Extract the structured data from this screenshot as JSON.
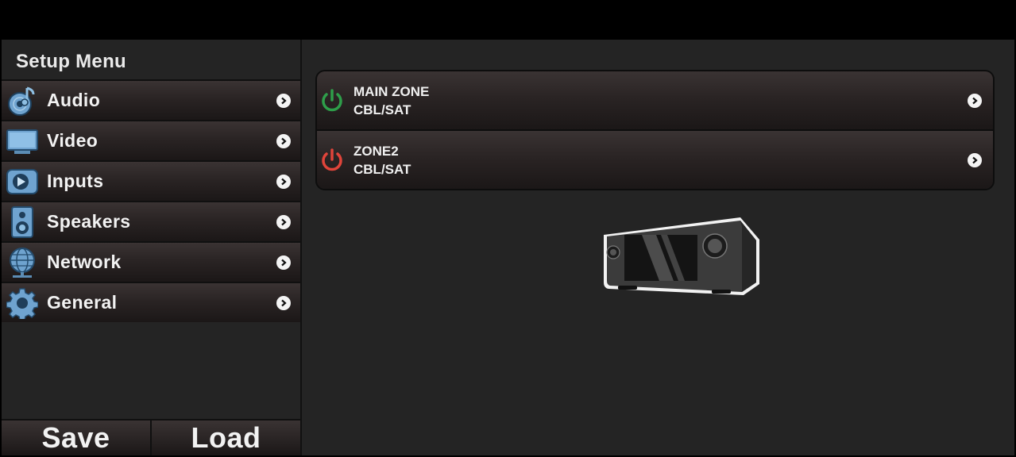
{
  "sidebar": {
    "title": "Setup Menu",
    "items": [
      {
        "label": "Audio",
        "icon": "audio-disc-icon"
      },
      {
        "label": "Video",
        "icon": "monitor-icon"
      },
      {
        "label": "Inputs",
        "icon": "input-arrow-icon"
      },
      {
        "label": "Speakers",
        "icon": "speaker-icon"
      },
      {
        "label": "Network",
        "icon": "globe-icon"
      },
      {
        "label": "General",
        "icon": "gear-icon"
      }
    ]
  },
  "footer": {
    "save_label": "Save",
    "load_label": "Load"
  },
  "zones": [
    {
      "name": "MAIN ZONE",
      "source": "CBL/SAT",
      "power_color": "#2e9e4a"
    },
    {
      "name": "ZONE2",
      "source": "CBL/SAT",
      "power_color": "#e0443a"
    }
  ],
  "colors": {
    "panel": "#242424",
    "accent_on": "#2e9e4a",
    "accent_off": "#e0443a"
  }
}
